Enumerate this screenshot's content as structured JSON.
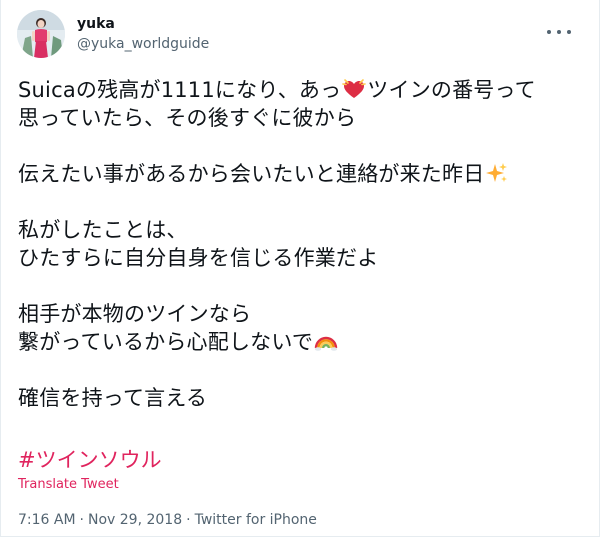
{
  "author": {
    "display_name": "yuka",
    "handle": "@yuka_worldguide"
  },
  "icons": {
    "more": "more-horizontal-icon",
    "twin_heart": "heart-with-ribbon-emoji",
    "sparkles": "sparkles-emoji",
    "rainbow": "rainbow-emoji"
  },
  "tweet": {
    "p1_line1_a": "Suicaの残高が1111になり、あっ",
    "p1_line1_b": "ツインの番号って",
    "p1_line2": "思っていたら、その後すぐに彼から",
    "p2_line1": "伝えたい事があるから会いたいと連絡が来た昨日",
    "p3_line1": "私がしたことは、",
    "p3_line2": "ひたすらに自分自身を信じる作業だよ",
    "p4_line1": "相手が本物のツインなら",
    "p4_line2": "繋がっているから心配しないで",
    "p5_line1": "確信を持って言える",
    "hashtag": "#ツインソウル",
    "translate": "Translate Tweet"
  },
  "meta": {
    "time": "7:16 AM",
    "separator": "·",
    "date": "Nov 29, 2018",
    "source": "Twitter for iPhone"
  },
  "colors": {
    "accent": "#e0245e",
    "secondary_text": "#536471",
    "primary_text": "#0f1419"
  }
}
